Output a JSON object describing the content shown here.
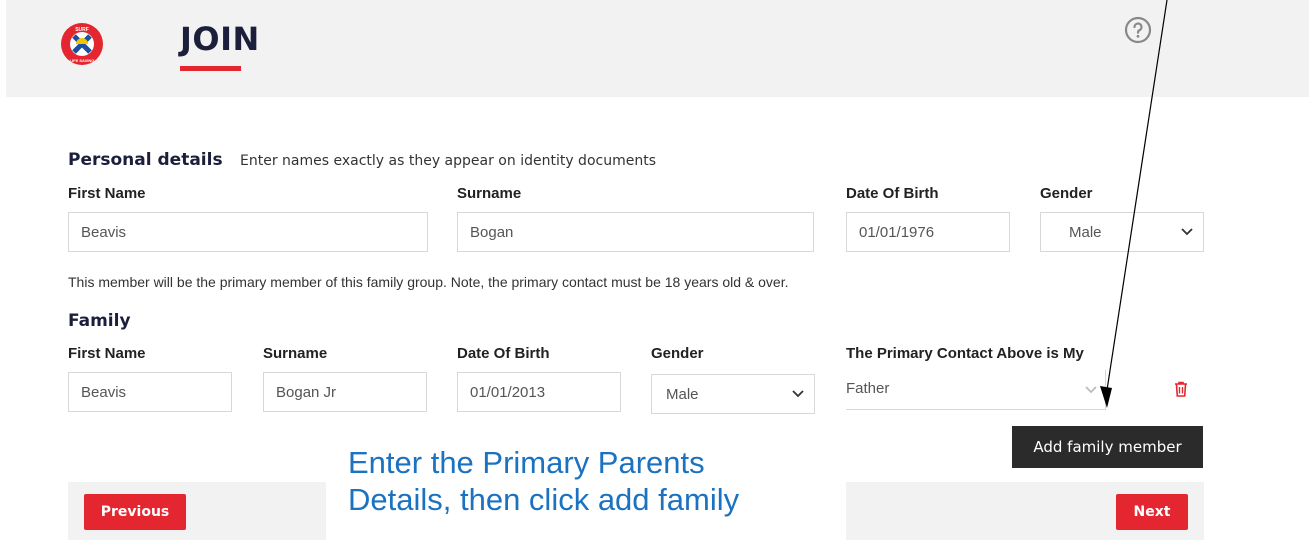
{
  "header": {
    "title": "JOIN",
    "help_icon": "help-circle-icon"
  },
  "logo": {
    "top_text": "SURF",
    "bottom_text": "LIFE SAVING"
  },
  "personal": {
    "title": "Personal details",
    "note": "Enter names exactly as they appear on identity documents",
    "first_name_label": "First Name",
    "first_name_value": "Beavis",
    "surname_label": "Surname",
    "surname_value": "Bogan",
    "dob_label": "Date Of Birth",
    "dob_value": "01/01/1976",
    "gender_label": "Gender",
    "gender_value": "Male"
  },
  "info_text": "This member will be the primary member of this family group. Note, the primary contact must be 18 years old & over.",
  "family": {
    "title": "Family",
    "first_name_label": "First Name",
    "first_name_value": "Beavis",
    "surname_label": "Surname",
    "surname_value": "Bogan Jr",
    "dob_label": "Date Of Birth",
    "dob_value": "01/01/2013",
    "gender_label": "Gender",
    "gender_value": "Male",
    "relation_label": "The Primary Contact Above is My",
    "relation_value": "Father"
  },
  "buttons": {
    "add_family": "Add family member",
    "previous": "Previous",
    "next": "Next"
  },
  "callout": {
    "line1": "Enter the Primary Parents",
    "line2": "Details, then click add family"
  },
  "colors": {
    "accent_red": "#e3262f",
    "navy": "#1b1f3b",
    "callout_blue": "#1b72c0"
  }
}
